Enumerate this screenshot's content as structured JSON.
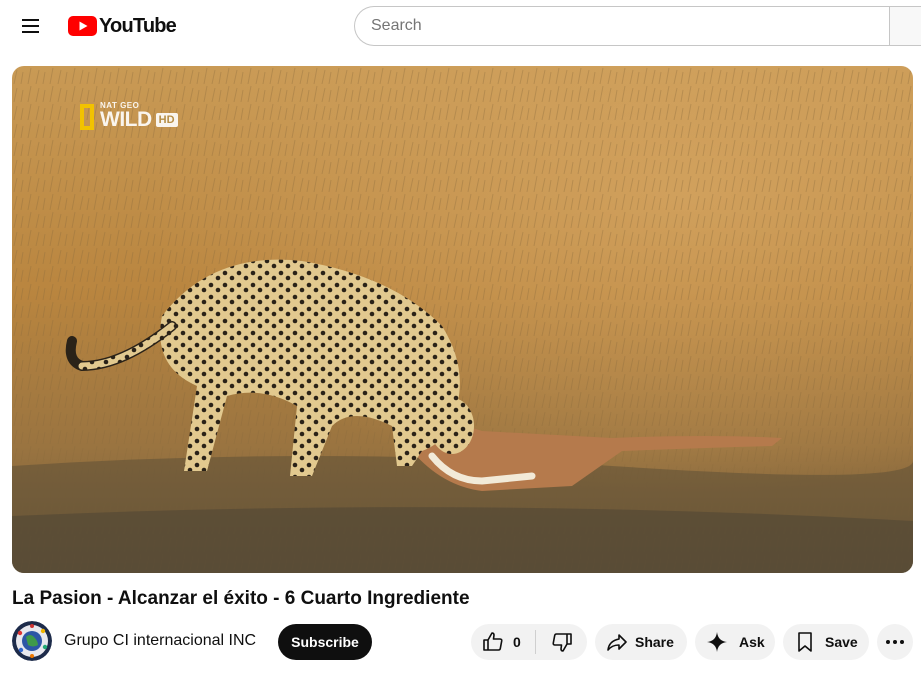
{
  "header": {
    "menu_icon": "hamburger-menu-icon",
    "logo_text": "YouTube",
    "search": {
      "placeholder": "Search",
      "value": ""
    }
  },
  "player": {
    "watermark": {
      "small": "NAT GEO",
      "big": "WILD",
      "badge": "HD"
    }
  },
  "video": {
    "title": "La Pasion - Alcanzar el éxito - 6 Cuarto Ingrediente"
  },
  "owner": {
    "channel_name": "Grupo CI internacional INC",
    "subscribe_label": "Subscribe"
  },
  "actions": {
    "like_count": "0",
    "share_label": "Share",
    "ask_label": "Ask",
    "save_label": "Save"
  },
  "colors": {
    "brand_red": "#ff0000",
    "text": "#0f0f0f",
    "pill_bg": "#f2f2f2",
    "subscribe_bg": "#0f0f0f"
  }
}
